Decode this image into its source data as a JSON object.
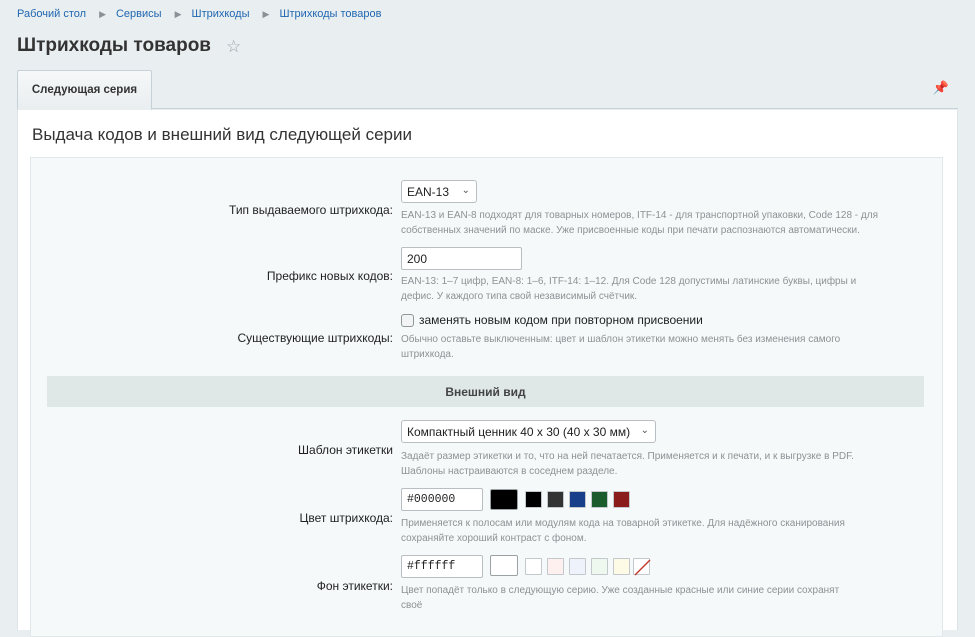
{
  "breadcrumb": [
    "Рабочий стол",
    "Сервисы",
    "Штрихкоды",
    "Штрихкоды товаров"
  ],
  "page_title": "Штрихкоды товаров",
  "tabs": [
    {
      "label": "Следующая серия"
    }
  ],
  "section_title": "Выдача кодов и внешний вид следующей серии",
  "fields": {
    "barcode_type": {
      "label": "Тип выдаваемого штрихкода:",
      "value": "EAN-13",
      "hint": "EAN-13 и EAN-8 подходят для товарных номеров, ITF-14 - для транспортной упаковки, Code 128 - для собственных значений по маске. Уже присвоенные коды при печати распознаются автоматически."
    },
    "prefix": {
      "label": "Префикс новых кодов:",
      "value": "200",
      "hint": "EAN-13: 1–7 цифр, EAN-8: 1–6, ITF-14: 1–12. Для Code 128 допустимы латинские буквы, цифры и дефис. У каждого типа свой независимый счётчик."
    },
    "existing": {
      "label": "Существующие штрихкоды:",
      "checkbox_label": "заменять новым кодом при повторном присвоении",
      "checked": false,
      "hint": "Обычно оставьте выключенным: цвет и шаблон этикетки можно менять без изменения самого штрихкода."
    }
  },
  "appearance": {
    "header": "Внешний вид",
    "template": {
      "label": "Шаблон этикетки",
      "value": "Компактный ценник 40 x 30 (40 x 30 мм)",
      "hint": "Задаёт размер этикетки и то, что на ней печатается. Применяется и к печати, и к выгрузке в PDF. Шаблоны настраиваются в соседнем разделе."
    },
    "barcode_color": {
      "label": "Цвет штрихкода:",
      "value": "#000000",
      "swatches": [
        "#000000",
        "#333333",
        "#1a3f8a",
        "#1c5b2c",
        "#8a1c1c"
      ],
      "hint": "Применяется к полосам или модулям кода на товарной этикетке. Для надёжного сканирования сохраняйте хороший контраст с фоном."
    },
    "label_bg": {
      "label": "Фон этикетки:",
      "value": "#ffffff",
      "swatches": [
        "#ffffff",
        "#fdf0ee",
        "#eef2fb",
        "#eef8ee",
        "#fdfbe6"
      ],
      "hint": "Цвет попадёт только в следующую серию. Уже созданные красные или синие серии сохранят своё"
    }
  }
}
